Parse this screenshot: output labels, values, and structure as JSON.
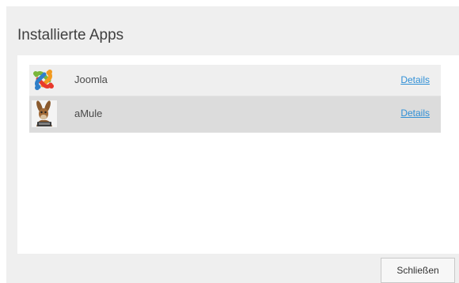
{
  "dialog": {
    "title": "Installierte Apps",
    "close_label": "Schließen"
  },
  "apps": [
    {
      "name": "Joomla",
      "details_label": "Details",
      "icon": "joomla-logo-icon"
    },
    {
      "name": "aMule",
      "details_label": "Details",
      "icon": "amule-mule-icon",
      "selected": true
    }
  ],
  "colors": {
    "dialog_background": "#efefef",
    "row_selected": "#dcdcdc",
    "link": "#2f8fd6"
  }
}
